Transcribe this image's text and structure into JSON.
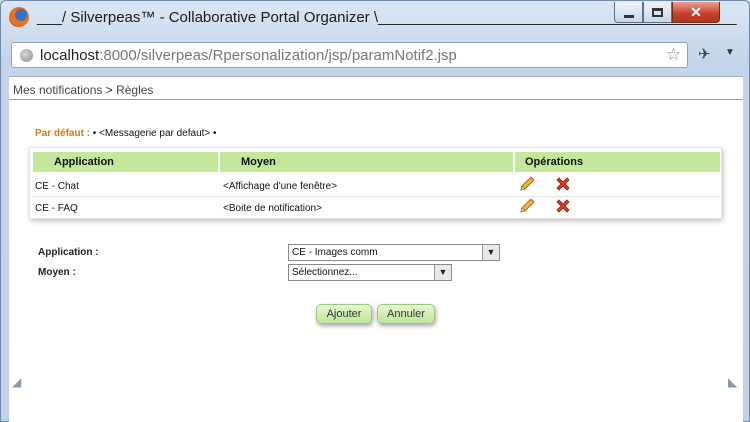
{
  "window": {
    "title": "___/ Silverpeas™ - Collaborative Portal Organizer \\___________________________________________",
    "url_host": "localhost",
    "url_rest": ":8000/silverpeas/Rpersonalization/jsp/paramNotif2.jsp",
    "close_glyph": "✕"
  },
  "breadcrumb": {
    "first": "Mes notifications",
    "separator": ">",
    "second": "Règles"
  },
  "default": {
    "label": "Par défaut :",
    "value": "• <Messagerie par defaut> •"
  },
  "table": {
    "headers": {
      "application": "Application",
      "moyen": "Moyen",
      "operations": "Opérations"
    },
    "rows": [
      {
        "application": "CE - Chat",
        "moyen": "<Affichage d'une fenêtre>"
      },
      {
        "application": "CE - FAQ",
        "moyen": "<Boite de notification>"
      }
    ]
  },
  "form": {
    "application_label": "Application :",
    "application_value": "CE - Images comm",
    "moyen_label": "Moyen :",
    "moyen_value": "Sélectionnez...",
    "add_label": "Ajouter",
    "cancel_label": "Annuler"
  },
  "colors": {
    "header_green": "#c4e89a",
    "default_label_orange": "#d37a12",
    "delete_red": "#d83a1e"
  },
  "icons": {
    "edit": "pencil-icon",
    "delete": "delete-icon"
  }
}
